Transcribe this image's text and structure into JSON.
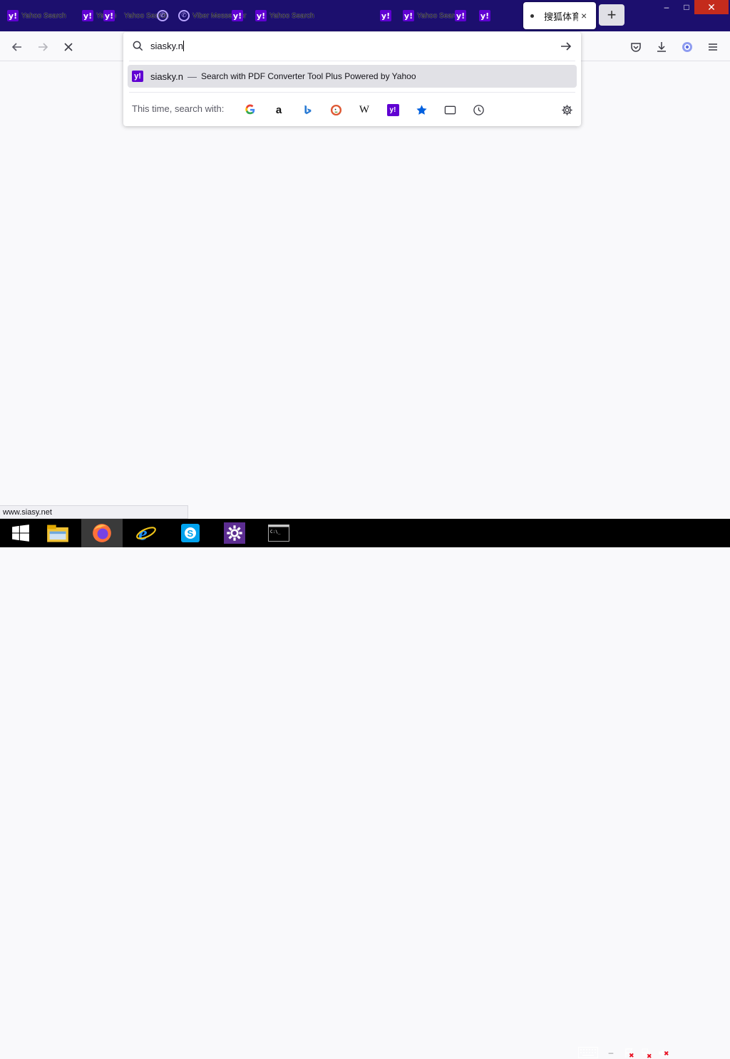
{
  "tabs": {
    "background": [
      {
        "icon": "yahoo-icon",
        "title": "Yahoo Search"
      },
      {
        "icon": "yahoo-icon",
        "title": "Yahoo"
      },
      {
        "icon": "yahoo-icon",
        "title": ""
      },
      {
        "icon": "yahoo-icon",
        "title": "Yahoo Search"
      },
      {
        "icon": "viber-icon",
        "title": ""
      },
      {
        "icon": "viber-icon",
        "title": "Viber Messenger"
      },
      {
        "icon": "yahoo-icon",
        "title": ""
      },
      {
        "icon": "yahoo-icon",
        "title": "Yahoo Search"
      },
      {
        "icon": "yahoo-icon",
        "title": ""
      },
      {
        "icon": "yahoo-icon",
        "title": "Yahoo Search"
      },
      {
        "icon": "yahoo-icon",
        "title": ""
      },
      {
        "icon": "yahoo-icon",
        "title": ""
      }
    ],
    "active": {
      "title": "搜狐体育",
      "close": "×"
    },
    "new_tab": "+"
  },
  "window_controls": {
    "minimize": "–",
    "maximize": "□",
    "close": "✕"
  },
  "url_bar": {
    "value": "siasky.n",
    "suggestion": {
      "text": "siasky.n",
      "separator": "—",
      "action": "Search with PDF Converter Tool Plus Powered by Yahoo"
    },
    "one_off_label": "This time, search with:",
    "engines": [
      "google-icon",
      "amazon-icon",
      "bing-icon",
      "duckduckgo-icon",
      "wikipedia-icon",
      "yahoo-icon",
      "bookmarks-icon",
      "tabs-icon",
      "history-icon"
    ],
    "engine_glyphs": {
      "wikipedia": "W",
      "yahoo": "y!",
      "amazon": "a"
    }
  },
  "status_bar": {
    "text": "www.siasy.net"
  },
  "colors": {
    "yahoo": "#6001d2",
    "tabbar": "#1c0f6e",
    "accent": "#0060df"
  }
}
